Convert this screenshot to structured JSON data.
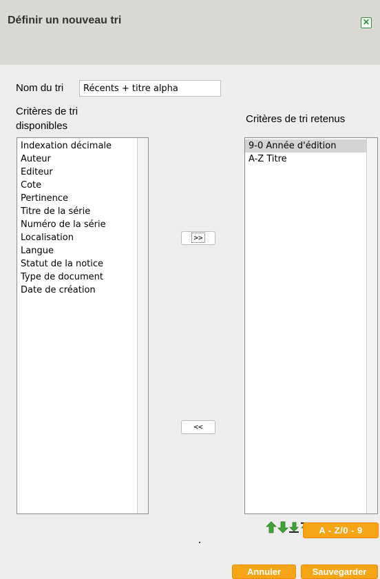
{
  "dialog": {
    "title": "Définir un nouveau tri",
    "close_symbol": "✕"
  },
  "form": {
    "name_label": "Nom du tri",
    "name_value": "Récents + titre alpha"
  },
  "available": {
    "label_line1": "Critères de tri",
    "label_line2": "disponibles",
    "items": [
      "Indexation décimale",
      "Auteur",
      "Editeur",
      "Cote",
      "Pertinence",
      "Titre de la série",
      "Numéro de la série",
      "Localisation",
      "Langue",
      "Statut de la notice",
      "Type de document",
      "Date de création"
    ]
  },
  "retained": {
    "label": "Critères de tri retenus",
    "items": [
      "9-0 Année d'édition",
      "A-Z Titre"
    ],
    "selected_index": 0
  },
  "buttons": {
    "add": ">>",
    "remove": "<<",
    "sort_toggle": "A - Z/0 - 9",
    "cancel": "Annuler",
    "save": "Sauvegarder"
  },
  "icons": {
    "move_up": "arrow-up-icon",
    "move_down": "arrow-down-icon",
    "move_bottom": "move-to-bottom-icon",
    "move_top": "move-to-top-icon"
  },
  "colors": {
    "titlebar": "#d9d8d3",
    "background": "#ededed",
    "accent": "#f6a516",
    "arrow_green": "#3fa535"
  }
}
